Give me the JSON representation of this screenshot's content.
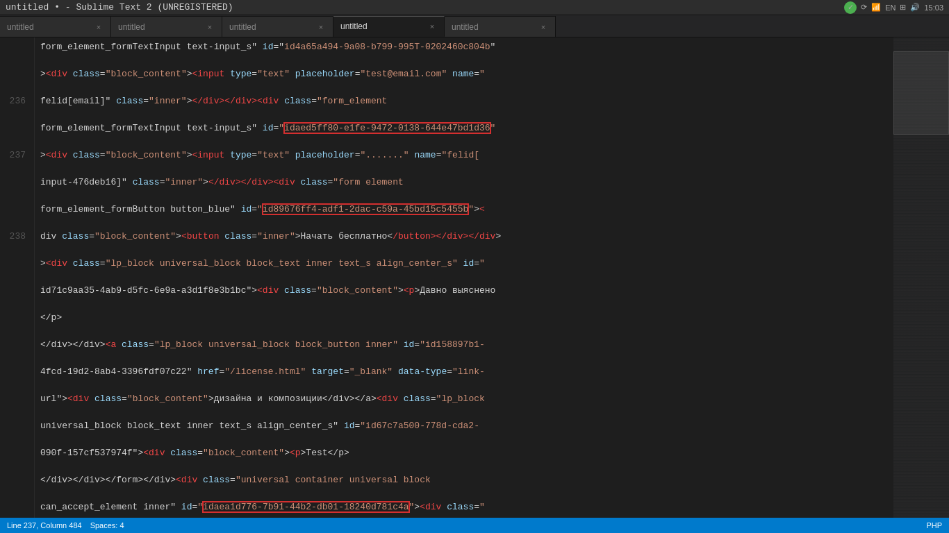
{
  "titlebar": {
    "title": "untitled • - Sublime Text 2 (UNREGISTERED)",
    "time": "15:03",
    "lang": "EN"
  },
  "tabs": [
    {
      "label": "untitled",
      "active": false
    },
    {
      "label": "untitled",
      "active": false
    },
    {
      "label": "untitled",
      "active": false
    },
    {
      "label": "untitled",
      "active": true
    },
    {
      "label": "untitled",
      "active": false
    }
  ],
  "statusbar": {
    "left": {
      "position": "Line 237, Column 484",
      "spaces": "Spaces: 4"
    },
    "right": {
      "lang": "PHP"
    }
  },
  "line_numbers": [
    "",
    "",
    "",
    "",
    "236",
    "",
    "",
    "",
    "237",
    "",
    "",
    "",
    "",
    "",
    "238"
  ],
  "code_lines": []
}
